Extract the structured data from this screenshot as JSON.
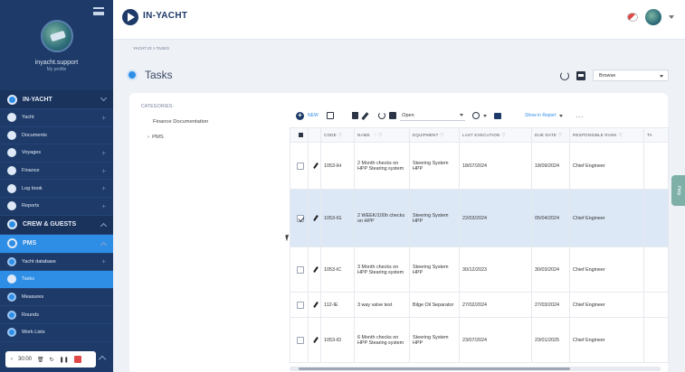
{
  "sidebar": {
    "user_name": "inyacht.support",
    "user_sub": "My profile",
    "items": [
      {
        "label": "IN-YACHT",
        "type": "section",
        "expand": "down"
      },
      {
        "label": "Yacht",
        "type": "item",
        "plus": true
      },
      {
        "label": "Documents",
        "type": "item",
        "plus": false
      },
      {
        "label": "Voyages",
        "type": "item",
        "plus": true
      },
      {
        "label": "Finance",
        "type": "item",
        "plus": true
      },
      {
        "label": "Log book",
        "type": "item",
        "plus": true
      },
      {
        "label": "Reports",
        "type": "item",
        "plus": true
      },
      {
        "label": "CREW & GUESTS",
        "type": "section",
        "expand": "up"
      },
      {
        "label": "PMS",
        "type": "section-active",
        "expand": "up"
      },
      {
        "label": "Yacht database",
        "type": "item",
        "plus": true
      },
      {
        "label": "Tasks",
        "type": "item-active",
        "plus": false
      },
      {
        "label": "Measures",
        "type": "item",
        "plus": false
      },
      {
        "label": "Rounds",
        "type": "item",
        "plus": false
      },
      {
        "label": "Work Lists",
        "type": "item",
        "plus": false
      }
    ],
    "timer": "30:00"
  },
  "header": {
    "brand": "IN-YACHT"
  },
  "breadcrumb": "YACHT ID > TASKS",
  "page": {
    "title": "Tasks",
    "view_select": "Browse"
  },
  "categories": {
    "title": "CATEGORIES:",
    "items": [
      "Finance Documentation",
      "PMS"
    ]
  },
  "toolbar": {
    "new_label": "NEW",
    "status_value": "Open",
    "show_report": "Show in Report",
    "more": "..."
  },
  "table": {
    "headers": [
      "CODE",
      "NAME",
      "EQUIPMENT",
      "LAST EXECUTION",
      "DUE DATE",
      "RESPONSIBLE RANK",
      "TA"
    ],
    "rows": [
      {
        "code": "1053-IH",
        "name": "2 Month checks on HPP Stearing system",
        "equipment": "Steering System HPP",
        "last_execution": "18/07/2024",
        "due_date": "18/09/2024",
        "rank": "Chief Engineer",
        "selected": false
      },
      {
        "code": "1053-IG",
        "name": "2 WEEK/100h checks on HPP",
        "equipment": "Steering System HPP",
        "last_execution": "22/03/2024",
        "due_date": "05/04/2024",
        "rank": "Chief Engineer",
        "selected": true
      },
      {
        "code": "1053-IC",
        "name": "3 Month checks on HPP Stearing system",
        "equipment": "Steering System HPP",
        "last_execution": "30/12/2023",
        "due_date": "30/03/2024",
        "rank": "Chief Engineer",
        "selected": false
      },
      {
        "code": "112-IE",
        "name": "3 way valve test",
        "equipment": "Bilge Oil Separator",
        "last_execution": "27/02/2024",
        "due_date": "27/03/2024",
        "rank": "Chief Engineer",
        "selected": false
      },
      {
        "code": "1053-ID",
        "name": "6 Month checks on HPP Stearing system",
        "equipment": "Steering System HPP",
        "last_execution": "23/07/2024",
        "due_date": "23/01/2025",
        "rank": "Chief Engineer",
        "selected": false
      }
    ]
  },
  "help_tab": "Help"
}
